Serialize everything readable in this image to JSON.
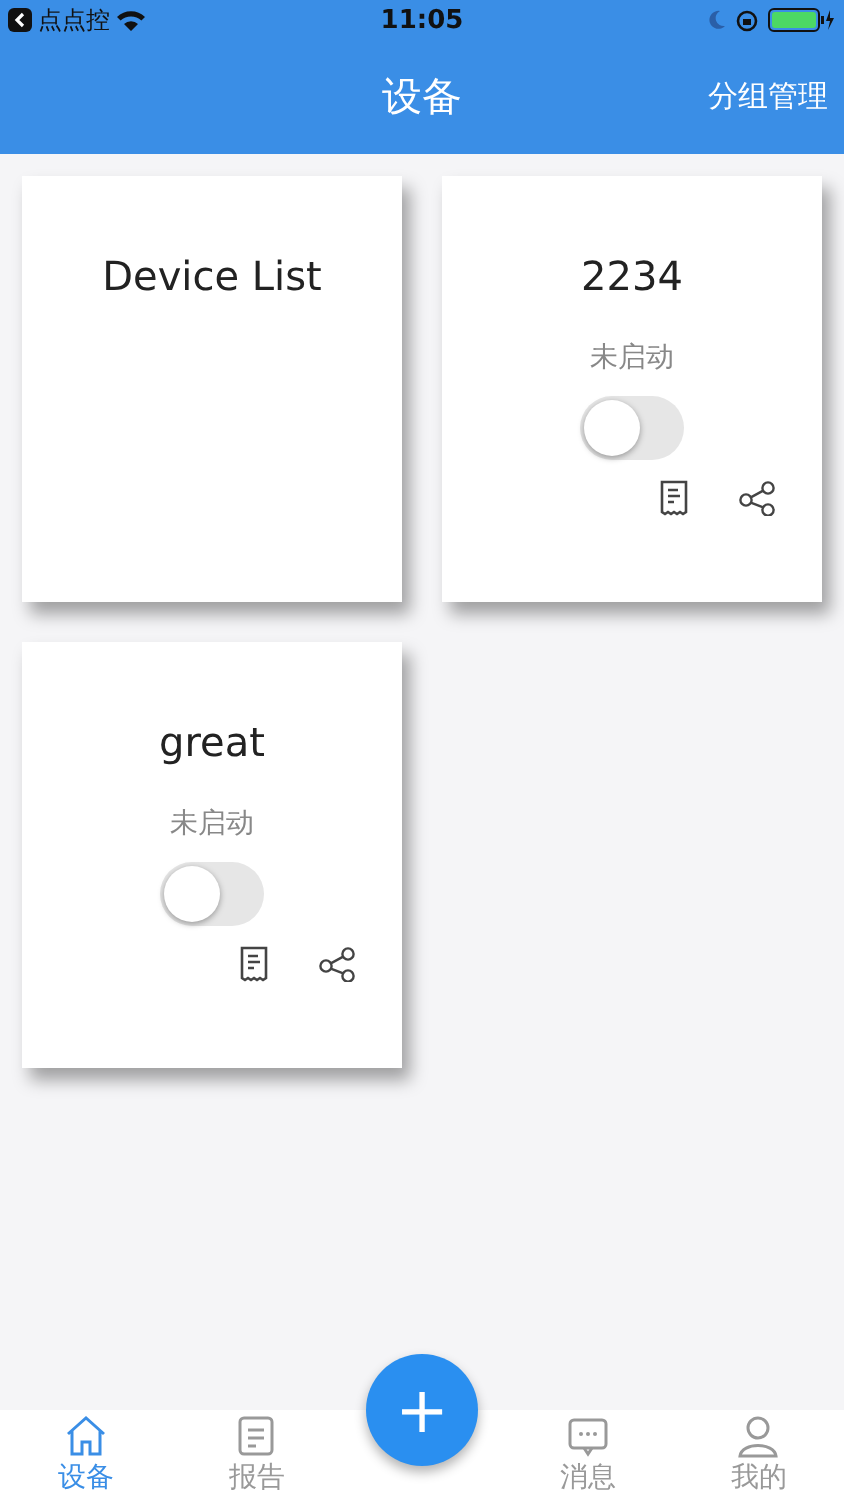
{
  "status_bar": {
    "back_app": "点点控",
    "time": "11:05"
  },
  "nav": {
    "title": "设备",
    "action": "分组管理"
  },
  "devices": [
    {
      "kind": "header",
      "name": "Device List"
    },
    {
      "kind": "device",
      "name": "2234",
      "status": "未启动",
      "on": false
    },
    {
      "kind": "device",
      "name": "great",
      "status": "未启动",
      "on": false
    }
  ],
  "tabs": [
    {
      "label": "设备",
      "selected": true
    },
    {
      "label": "报告",
      "selected": false
    },
    {
      "label": "消息",
      "selected": false
    },
    {
      "label": "我的",
      "selected": false
    }
  ],
  "fab": {
    "label": "+"
  }
}
